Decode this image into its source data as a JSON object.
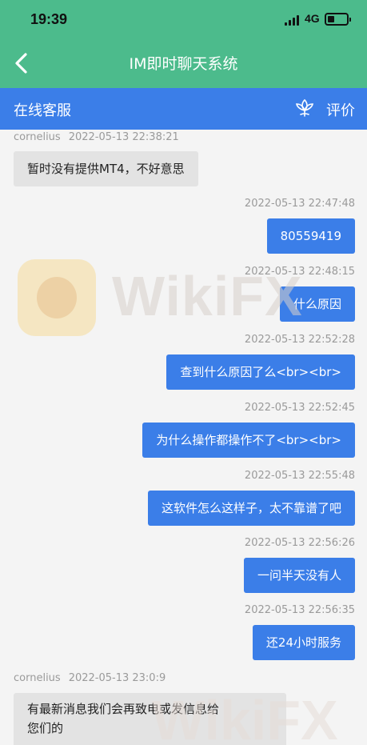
{
  "status_bar": {
    "time": "19:39",
    "network": "4G"
  },
  "navbar": {
    "title": "IM即时聊天系统"
  },
  "service_bar": {
    "title": "在线客服",
    "rate_label": "评价"
  },
  "watermark": {
    "text": "WikiFX"
  },
  "messages": [
    {
      "direction": "in",
      "sender": "cornelius",
      "time": "2022-05-13 22:38:21",
      "text": "暂时没有提供MT4，不好意思"
    },
    {
      "direction": "out",
      "time": "2022-05-13 22:47:48",
      "text": "80559419"
    },
    {
      "direction": "out",
      "time": "2022-05-13 22:48:15",
      "text": "什么原因"
    },
    {
      "direction": "out",
      "time": "2022-05-13 22:52:28",
      "text": "查到什么原因了么<br><br>"
    },
    {
      "direction": "out",
      "time": "2022-05-13 22:52:45",
      "text": "为什么操作都操作不了<br><br>"
    },
    {
      "direction": "out",
      "time": "2022-05-13 22:55:48",
      "text": "这软件怎么这样子，太不靠谱了吧"
    },
    {
      "direction": "out",
      "time": "2022-05-13 22:56:26",
      "text": "一问半天没有人"
    },
    {
      "direction": "out",
      "time": "2022-05-13 22:56:35",
      "text": "还24小时服务"
    },
    {
      "direction": "in",
      "sender": "cornelius",
      "time": "2022-05-13 23:0:9",
      "text_lines": [
        "有最新消息我们会再致电或发信息给",
        "您们的"
      ]
    }
  ]
}
